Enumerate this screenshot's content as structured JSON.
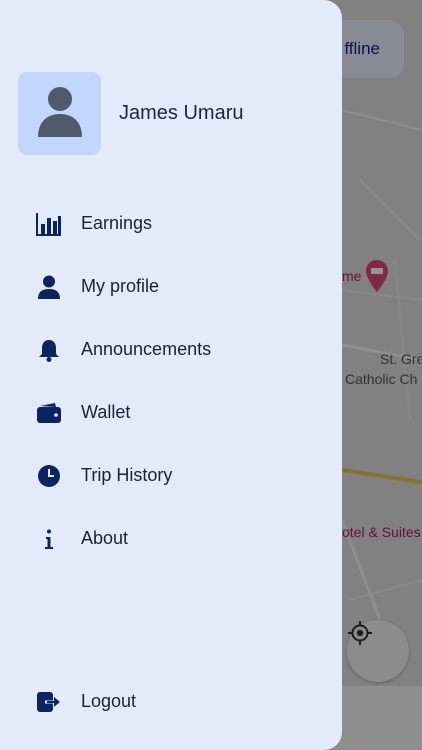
{
  "map": {
    "labels": {
      "home_fragment": "me",
      "church_line1": "St. Gre",
      "church_line2": "Catholic Ch",
      "hotel": "otel & Suites"
    },
    "status_chip": "ffline"
  },
  "drawer": {
    "user_name": "James Umaru",
    "avatar_icon": "person-icon",
    "items": [
      {
        "label": "Earnings",
        "icon": "bar-chart-icon"
      },
      {
        "label": "My profile",
        "icon": "person-icon"
      },
      {
        "label": "Announcements",
        "icon": "bell-icon"
      },
      {
        "label": "Wallet",
        "icon": "wallet-icon"
      },
      {
        "label": "Trip History",
        "icon": "clock-icon"
      },
      {
        "label": "About",
        "icon": "info-icon"
      }
    ],
    "logout": {
      "label": "Logout",
      "icon": "logout-icon"
    }
  },
  "colors": {
    "drawer_bg": "#e3ebfb",
    "icon_navy": "#0d2463",
    "avatar_bg": "#c3d6fb"
  }
}
